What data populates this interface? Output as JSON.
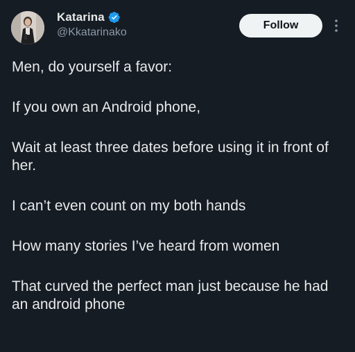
{
  "author": {
    "display_name": "Katarina",
    "handle": "@Kkatarinako",
    "verified": true
  },
  "actions": {
    "follow_label": "Follow",
    "more_icon": "more-vertical-icon"
  },
  "tweet": {
    "paragraphs": [
      "Men, do yourself a favor:",
      "If you own an Android phone,",
      "Wait at least three dates before using it in front of her.",
      "I can’t even count on my both hands",
      "How many stories I’ve heard from women",
      "That curved the perfect man just because he had an android phone"
    ]
  },
  "colors": {
    "background": "#161c24",
    "text": "#e7e9ea",
    "secondary_text": "#8b98a5",
    "verified_badge": "#1d9bf0",
    "follow_button_bg": "#eff3f4"
  }
}
